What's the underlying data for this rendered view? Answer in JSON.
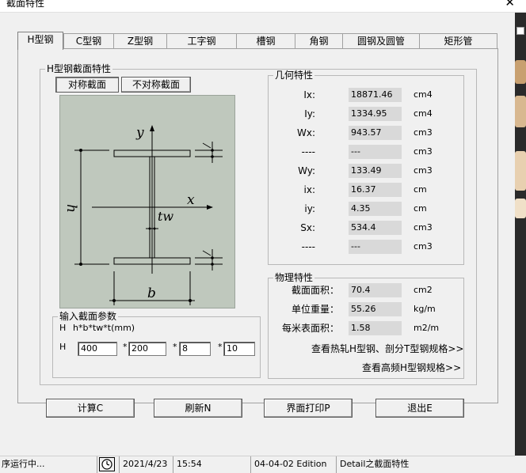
{
  "window": {
    "title": "截面特性",
    "close_glyph": "✕"
  },
  "tabs": [
    {
      "label": "H型钢",
      "active": true
    },
    {
      "label": "C型钢",
      "active": false
    },
    {
      "label": "Z型钢",
      "active": false
    },
    {
      "label": "工字钢",
      "active": false
    },
    {
      "label": "槽钢",
      "active": false
    },
    {
      "label": "角钢",
      "active": false
    },
    {
      "label": "圆钢及圆管",
      "active": false
    },
    {
      "label": "矩形管",
      "active": false
    }
  ],
  "section": {
    "legend": "H型钢截面特性",
    "sym_button": "对称截面",
    "asym_button": "不对称截面"
  },
  "drawing_labels": {
    "y": "y",
    "x": "x",
    "h": "h",
    "tw": "tw",
    "b": "b"
  },
  "input_group": {
    "legend": "输入截面参数",
    "hint_prefix": "H",
    "hint": "h*b*tw*t(mm)",
    "row_prefix": "H",
    "sep": "*",
    "values": [
      "400",
      "200",
      "8",
      "10"
    ]
  },
  "geometry": {
    "legend": "几何特性",
    "rows": [
      {
        "label": "Ix:",
        "value": "18871.46",
        "unit": "cm4"
      },
      {
        "label": "Iy:",
        "value": "1334.95",
        "unit": "cm4"
      },
      {
        "label": "Wx:",
        "value": "943.57",
        "unit": "cm3"
      },
      {
        "label": "----",
        "value": "---",
        "unit": "cm3"
      },
      {
        "label": "Wy:",
        "value": "133.49",
        "unit": "cm3"
      },
      {
        "label": "ix:",
        "value": "16.37",
        "unit": "cm"
      },
      {
        "label": "iy:",
        "value": "4.35",
        "unit": "cm"
      },
      {
        "label": "Sx:",
        "value": "534.4",
        "unit": "cm3"
      },
      {
        "label": "----",
        "value": "---",
        "unit": "cm3"
      }
    ]
  },
  "physical": {
    "legend": "物理特性",
    "rows": [
      {
        "label": "截面面积：",
        "value": "70.4",
        "unit": "cm2"
      },
      {
        "label": "单位重量：",
        "value": "55.26",
        "unit": "kg/m"
      },
      {
        "label": "每米表面积：",
        "value": "1.58",
        "unit": "m2/m"
      }
    ],
    "link1": "查看热轧H型钢、剖分T型钢规格>>",
    "link2": "查看高频H型钢规格>>"
  },
  "buttons": {
    "calc": "计算C",
    "refresh": "刷新N",
    "print": "界面打印P",
    "exit": "退出E"
  },
  "status": {
    "left": "序运行中...",
    "date": "2021/4/23",
    "time": "15:54",
    "edition": "04-04-02 Edition",
    "module": "Detail之截面特性"
  },
  "colors": {
    "drawing_bg": "#bfc8bd",
    "value_bg": "#d9d9d9"
  }
}
